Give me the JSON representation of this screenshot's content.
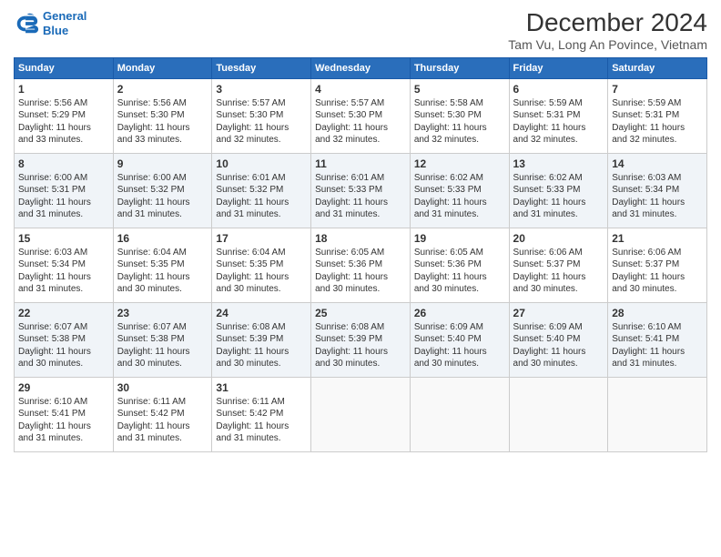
{
  "header": {
    "logo_line1": "General",
    "logo_line2": "Blue",
    "title": "December 2024",
    "subtitle": "Tam Vu, Long An Povince, Vietnam"
  },
  "weekdays": [
    "Sunday",
    "Monday",
    "Tuesday",
    "Wednesday",
    "Thursday",
    "Friday",
    "Saturday"
  ],
  "weeks": [
    [
      {
        "day": "1",
        "lines": [
          "Sunrise: 5:56 AM",
          "Sunset: 5:29 PM",
          "Daylight: 11 hours",
          "and 33 minutes."
        ]
      },
      {
        "day": "2",
        "lines": [
          "Sunrise: 5:56 AM",
          "Sunset: 5:30 PM",
          "Daylight: 11 hours",
          "and 33 minutes."
        ]
      },
      {
        "day": "3",
        "lines": [
          "Sunrise: 5:57 AM",
          "Sunset: 5:30 PM",
          "Daylight: 11 hours",
          "and 32 minutes."
        ]
      },
      {
        "day": "4",
        "lines": [
          "Sunrise: 5:57 AM",
          "Sunset: 5:30 PM",
          "Daylight: 11 hours",
          "and 32 minutes."
        ]
      },
      {
        "day": "5",
        "lines": [
          "Sunrise: 5:58 AM",
          "Sunset: 5:30 PM",
          "Daylight: 11 hours",
          "and 32 minutes."
        ]
      },
      {
        "day": "6",
        "lines": [
          "Sunrise: 5:59 AM",
          "Sunset: 5:31 PM",
          "Daylight: 11 hours",
          "and 32 minutes."
        ]
      },
      {
        "day": "7",
        "lines": [
          "Sunrise: 5:59 AM",
          "Sunset: 5:31 PM",
          "Daylight: 11 hours",
          "and 32 minutes."
        ]
      }
    ],
    [
      {
        "day": "8",
        "lines": [
          "Sunrise: 6:00 AM",
          "Sunset: 5:31 PM",
          "Daylight: 11 hours",
          "and 31 minutes."
        ]
      },
      {
        "day": "9",
        "lines": [
          "Sunrise: 6:00 AM",
          "Sunset: 5:32 PM",
          "Daylight: 11 hours",
          "and 31 minutes."
        ]
      },
      {
        "day": "10",
        "lines": [
          "Sunrise: 6:01 AM",
          "Sunset: 5:32 PM",
          "Daylight: 11 hours",
          "and 31 minutes."
        ]
      },
      {
        "day": "11",
        "lines": [
          "Sunrise: 6:01 AM",
          "Sunset: 5:33 PM",
          "Daylight: 11 hours",
          "and 31 minutes."
        ]
      },
      {
        "day": "12",
        "lines": [
          "Sunrise: 6:02 AM",
          "Sunset: 5:33 PM",
          "Daylight: 11 hours",
          "and 31 minutes."
        ]
      },
      {
        "day": "13",
        "lines": [
          "Sunrise: 6:02 AM",
          "Sunset: 5:33 PM",
          "Daylight: 11 hours",
          "and 31 minutes."
        ]
      },
      {
        "day": "14",
        "lines": [
          "Sunrise: 6:03 AM",
          "Sunset: 5:34 PM",
          "Daylight: 11 hours",
          "and 31 minutes."
        ]
      }
    ],
    [
      {
        "day": "15",
        "lines": [
          "Sunrise: 6:03 AM",
          "Sunset: 5:34 PM",
          "Daylight: 11 hours",
          "and 31 minutes."
        ]
      },
      {
        "day": "16",
        "lines": [
          "Sunrise: 6:04 AM",
          "Sunset: 5:35 PM",
          "Daylight: 11 hours",
          "and 30 minutes."
        ]
      },
      {
        "day": "17",
        "lines": [
          "Sunrise: 6:04 AM",
          "Sunset: 5:35 PM",
          "Daylight: 11 hours",
          "and 30 minutes."
        ]
      },
      {
        "day": "18",
        "lines": [
          "Sunrise: 6:05 AM",
          "Sunset: 5:36 PM",
          "Daylight: 11 hours",
          "and 30 minutes."
        ]
      },
      {
        "day": "19",
        "lines": [
          "Sunrise: 6:05 AM",
          "Sunset: 5:36 PM",
          "Daylight: 11 hours",
          "and 30 minutes."
        ]
      },
      {
        "day": "20",
        "lines": [
          "Sunrise: 6:06 AM",
          "Sunset: 5:37 PM",
          "Daylight: 11 hours",
          "and 30 minutes."
        ]
      },
      {
        "day": "21",
        "lines": [
          "Sunrise: 6:06 AM",
          "Sunset: 5:37 PM",
          "Daylight: 11 hours",
          "and 30 minutes."
        ]
      }
    ],
    [
      {
        "day": "22",
        "lines": [
          "Sunrise: 6:07 AM",
          "Sunset: 5:38 PM",
          "Daylight: 11 hours",
          "and 30 minutes."
        ]
      },
      {
        "day": "23",
        "lines": [
          "Sunrise: 6:07 AM",
          "Sunset: 5:38 PM",
          "Daylight: 11 hours",
          "and 30 minutes."
        ]
      },
      {
        "day": "24",
        "lines": [
          "Sunrise: 6:08 AM",
          "Sunset: 5:39 PM",
          "Daylight: 11 hours",
          "and 30 minutes."
        ]
      },
      {
        "day": "25",
        "lines": [
          "Sunrise: 6:08 AM",
          "Sunset: 5:39 PM",
          "Daylight: 11 hours",
          "and 30 minutes."
        ]
      },
      {
        "day": "26",
        "lines": [
          "Sunrise: 6:09 AM",
          "Sunset: 5:40 PM",
          "Daylight: 11 hours",
          "and 30 minutes."
        ]
      },
      {
        "day": "27",
        "lines": [
          "Sunrise: 6:09 AM",
          "Sunset: 5:40 PM",
          "Daylight: 11 hours",
          "and 30 minutes."
        ]
      },
      {
        "day": "28",
        "lines": [
          "Sunrise: 6:10 AM",
          "Sunset: 5:41 PM",
          "Daylight: 11 hours",
          "and 31 minutes."
        ]
      }
    ],
    [
      {
        "day": "29",
        "lines": [
          "Sunrise: 6:10 AM",
          "Sunset: 5:41 PM",
          "Daylight: 11 hours",
          "and 31 minutes."
        ]
      },
      {
        "day": "30",
        "lines": [
          "Sunrise: 6:11 AM",
          "Sunset: 5:42 PM",
          "Daylight: 11 hours",
          "and 31 minutes."
        ]
      },
      {
        "day": "31",
        "lines": [
          "Sunrise: 6:11 AM",
          "Sunset: 5:42 PM",
          "Daylight: 11 hours",
          "and 31 minutes."
        ]
      },
      null,
      null,
      null,
      null
    ]
  ]
}
